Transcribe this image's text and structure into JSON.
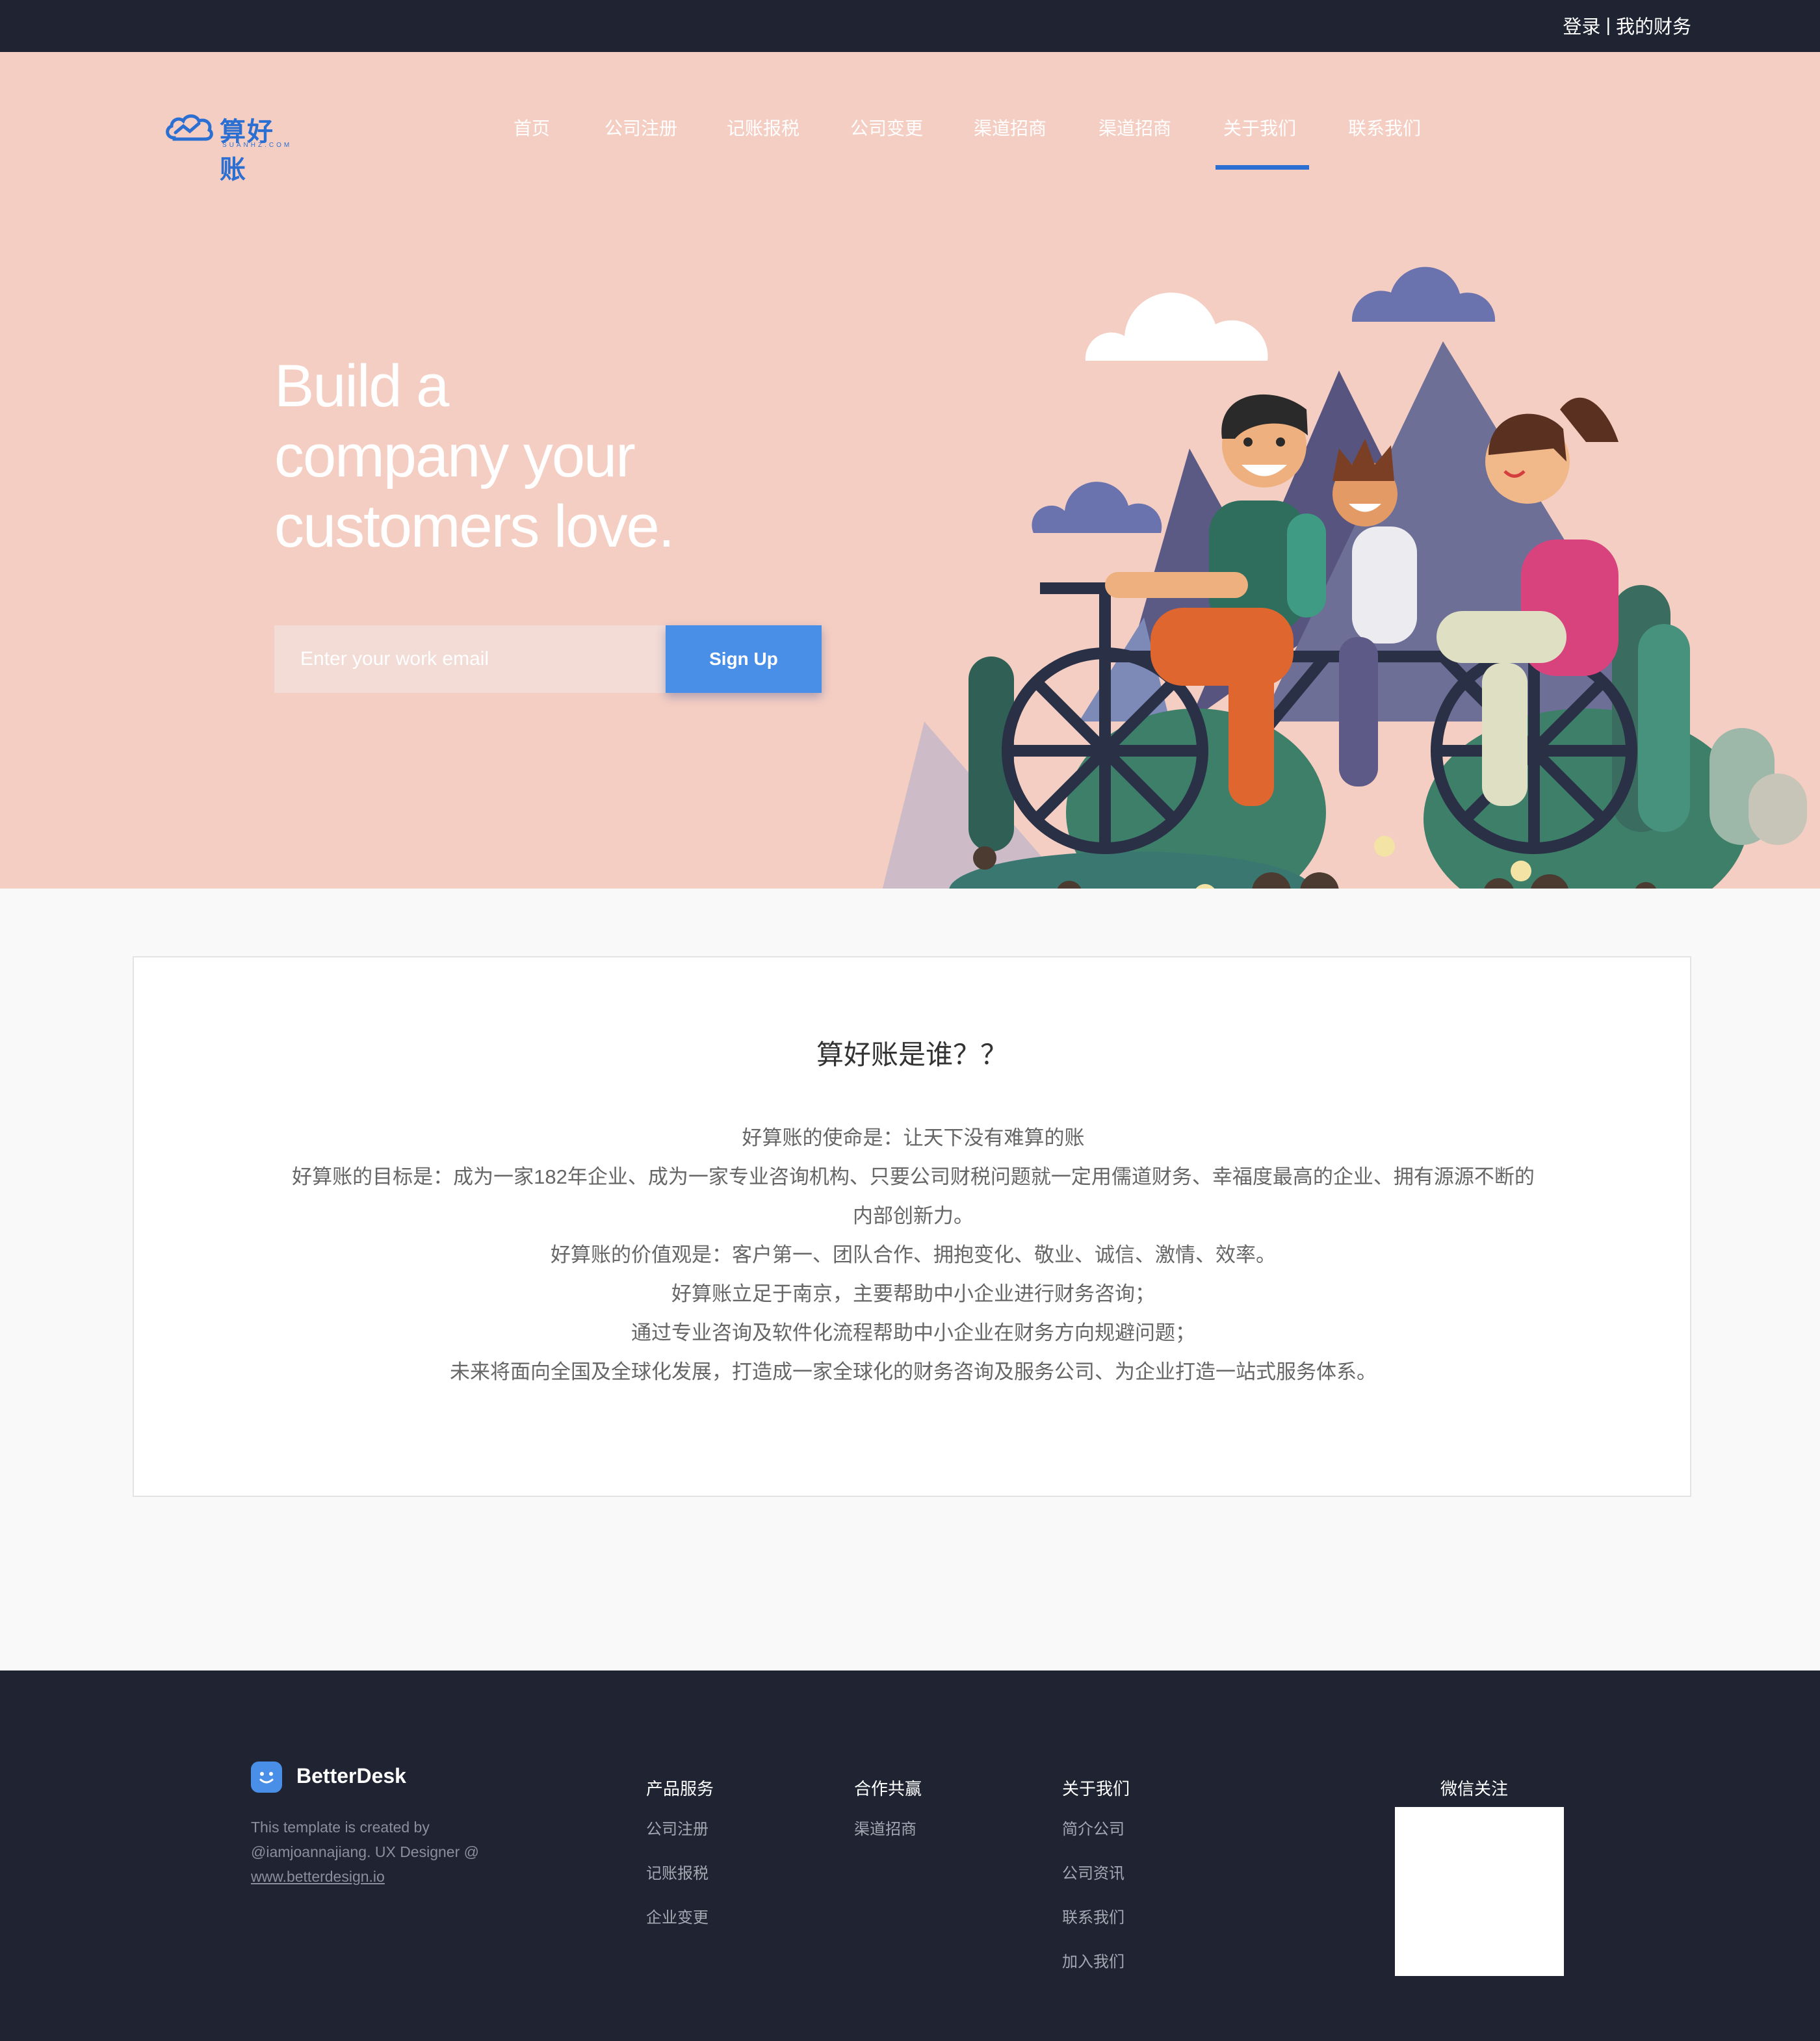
{
  "topbar": {
    "login": "登录",
    "separator": "|",
    "finance": "我的财务"
  },
  "logo": {
    "text": "算好账",
    "sub": "SUANHZ.COM"
  },
  "nav": {
    "items": [
      "首页",
      "公司注册",
      "记账报税",
      "公司变更",
      "渠道招商",
      "渠道招商",
      "关于我们",
      "联系我们"
    ],
    "active_index": 6
  },
  "hero": {
    "headline_1": "Build a",
    "headline_2": "company your",
    "headline_3": "customers love.",
    "email_placeholder": "Enter your work email",
    "signup_label": "Sign Up"
  },
  "about": {
    "title": "算好账是谁？？",
    "lines": [
      "好算账的使命是：让天下没有难算的账",
      "好算账的目标是：成为一家182年企业、成为一家专业咨询机构、只要公司财税问题就一定用儒道财务、幸福度最高的企业、拥有源源不断的",
      "内部创新力。",
      "好算账的价值观是：客户第一、团队合作、拥抱变化、敬业、诚信、激情、效率。",
      "好算账立足于南京，主要帮助中小企业进行财务咨询；",
      "通过专业咨询及软件化流程帮助中小企业在财务方向规避问题；",
      "未来将面向全国及全球化发展，打造成一家全球化的财务咨询及服务公司、为企业打造一站式服务体系。"
    ]
  },
  "footer": {
    "brand_name": "BetterDesk",
    "brand_desc_1": "This template is created by",
    "brand_desc_2": "@iamjoannajiang. UX Designer @",
    "brand_link": "www.betterdesign.io",
    "columns": [
      {
        "title": "产品服务",
        "items": [
          "公司注册",
          "记账报税",
          "企业变更"
        ]
      },
      {
        "title": "合作共赢",
        "items": [
          "渠道招商"
        ]
      },
      {
        "title": "关于我们",
        "items": [
          "简介公司",
          "公司资讯",
          "联系我们",
          "加入我们"
        ]
      }
    ],
    "wechat_title": "微信关注"
  },
  "colors": {
    "topbar_bg": "#1f2332",
    "hero_bg": "#f5cec3",
    "accent_blue": "#2a6fd1",
    "button_blue": "#4a8fe7",
    "footer_bg": "#1f2332"
  }
}
